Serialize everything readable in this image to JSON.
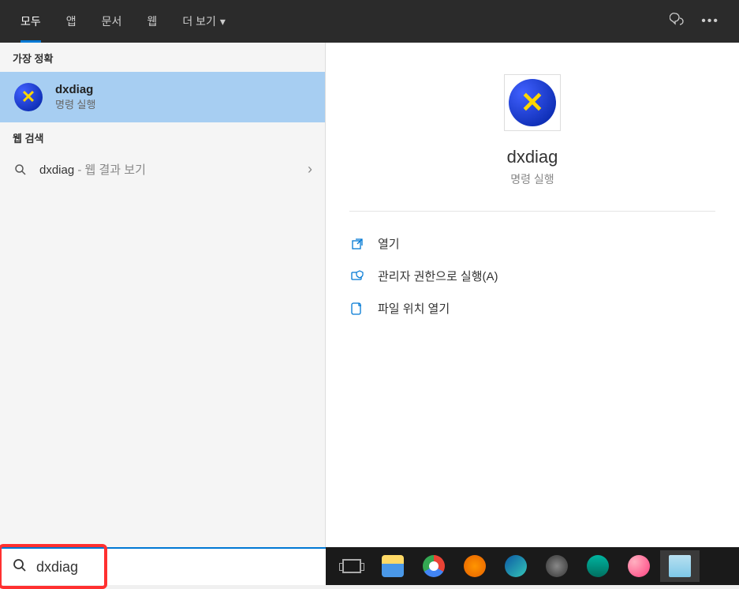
{
  "header": {
    "tabs": {
      "all": "모두",
      "apps": "앱",
      "docs": "문서",
      "web": "웹",
      "more": "더 보기"
    }
  },
  "leftPanel": {
    "bestMatchHeader": "가장 정확",
    "webSearchHeader": "웹 검색",
    "bestMatch": {
      "title": "dxdiag",
      "subtitle": "명령 실행"
    },
    "webResult": {
      "query": "dxdiag",
      "suffix": " - 웹 결과 보기"
    }
  },
  "preview": {
    "title": "dxdiag",
    "subtitle": "명령 실행",
    "actions": {
      "open": "열기",
      "runAsAdmin": "관리자 권한으로 실행(A)",
      "openLocation": "파일 위치 열기"
    }
  },
  "search": {
    "value": "dxdiag"
  }
}
